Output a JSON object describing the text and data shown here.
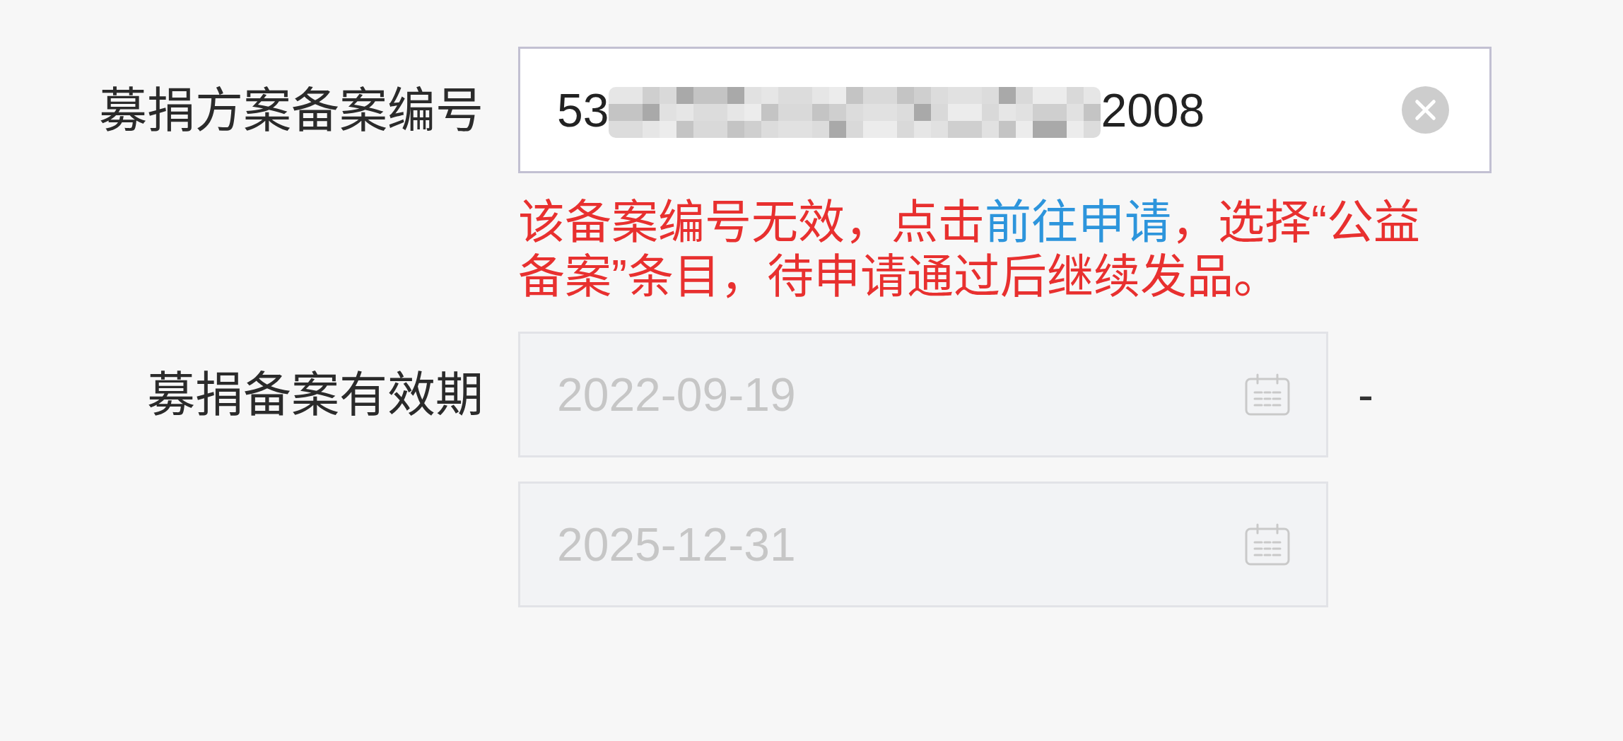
{
  "record_number": {
    "label": "募捐方案备案编号",
    "field": {
      "value_start": "53",
      "redacted": true,
      "value_end": "2008"
    },
    "error_message": [
      {
        "kind": "text",
        "text": "该备案编号无效，点击"
      },
      {
        "kind": "link",
        "text": "前往申请"
      },
      {
        "kind": "text",
        "text": "，选择“公益备案”条目，待申请通过后继续发品。"
      }
    ]
  },
  "validity_period": {
    "label": "募捐备案有效期",
    "start_date": {
      "value": "2022-09-19",
      "disabled": true
    },
    "separator": "-",
    "end_date": {
      "value": "2025-12-31",
      "disabled": true
    }
  }
}
